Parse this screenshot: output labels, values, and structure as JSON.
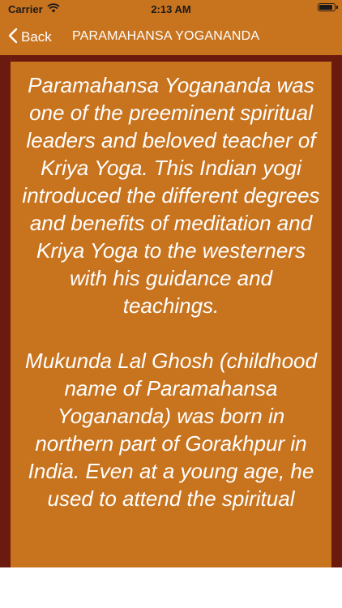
{
  "status_bar": {
    "carrier": "Carrier",
    "time": "2:13 AM",
    "battery_level": 0.9
  },
  "nav_bar": {
    "back_label": "Back",
    "title": "PARAMAHANSA YOGANANDA"
  },
  "article": {
    "paragraphs": [
      "Paramahansa Yogananda was one of the preeminent spiritual leaders and beloved teacher of Kriya Yoga. This Indian yogi introduced the different degrees and benefits of meditation and Kriya Yoga to the westerners with his guidance and teachings.",
      "Mukunda Lal Ghosh (childhood name of Paramahansa Yogananda) was born in northern part of Gorakhpur in India. Even at a young age, he used to attend the spiritual"
    ]
  },
  "colors": {
    "background": "#c8731e",
    "frame": "#6b1a0e",
    "text": "#ffffff"
  }
}
